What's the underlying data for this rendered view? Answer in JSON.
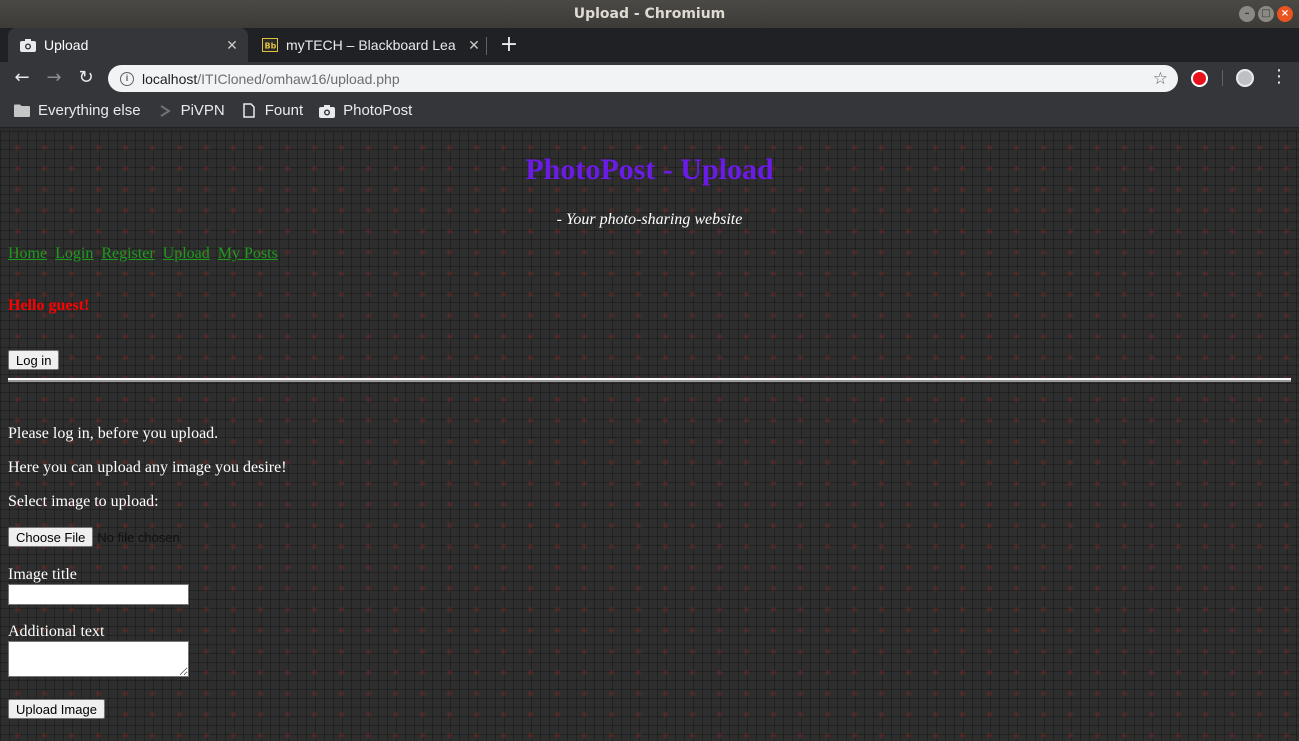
{
  "window": {
    "title": "Upload - Chromium"
  },
  "tabs": [
    {
      "label": "Upload",
      "icon": "camera-icon"
    },
    {
      "label": "myTECH – Blackboard Lea",
      "icon": "blackboard-icon"
    }
  ],
  "address": {
    "host": "localhost",
    "path": "/ITICloned/omhaw16/upload.php"
  },
  "bookmarks": [
    {
      "label": "Everything else",
      "icon": "folder-icon"
    },
    {
      "label": "PiVPN",
      "icon": "pivpn-icon"
    },
    {
      "label": "Fount",
      "icon": "document-icon"
    },
    {
      "label": "PhotoPost",
      "icon": "camera-icon"
    }
  ],
  "page": {
    "title": "PhotoPost - Upload",
    "tagline": "- Your photo-sharing website",
    "nav": [
      "Home",
      "Login",
      "Register",
      "Upload",
      "My Posts"
    ],
    "greeting": "Hello guest!",
    "login_button": "Log in",
    "messages": [
      "Please log in, before you upload.",
      "Here you can upload any image you desire!",
      "Select image to upload:"
    ],
    "choose_file_button": "Choose File",
    "file_status": "No file chosen",
    "image_title_label": "Image title",
    "image_title_value": "",
    "additional_text_label": "Additional text",
    "additional_text_value": "",
    "upload_button": "Upload Image"
  },
  "colors": {
    "title": "#6a1be6",
    "nav_link": "#1f9a1f",
    "greeting": "#ff0000"
  }
}
